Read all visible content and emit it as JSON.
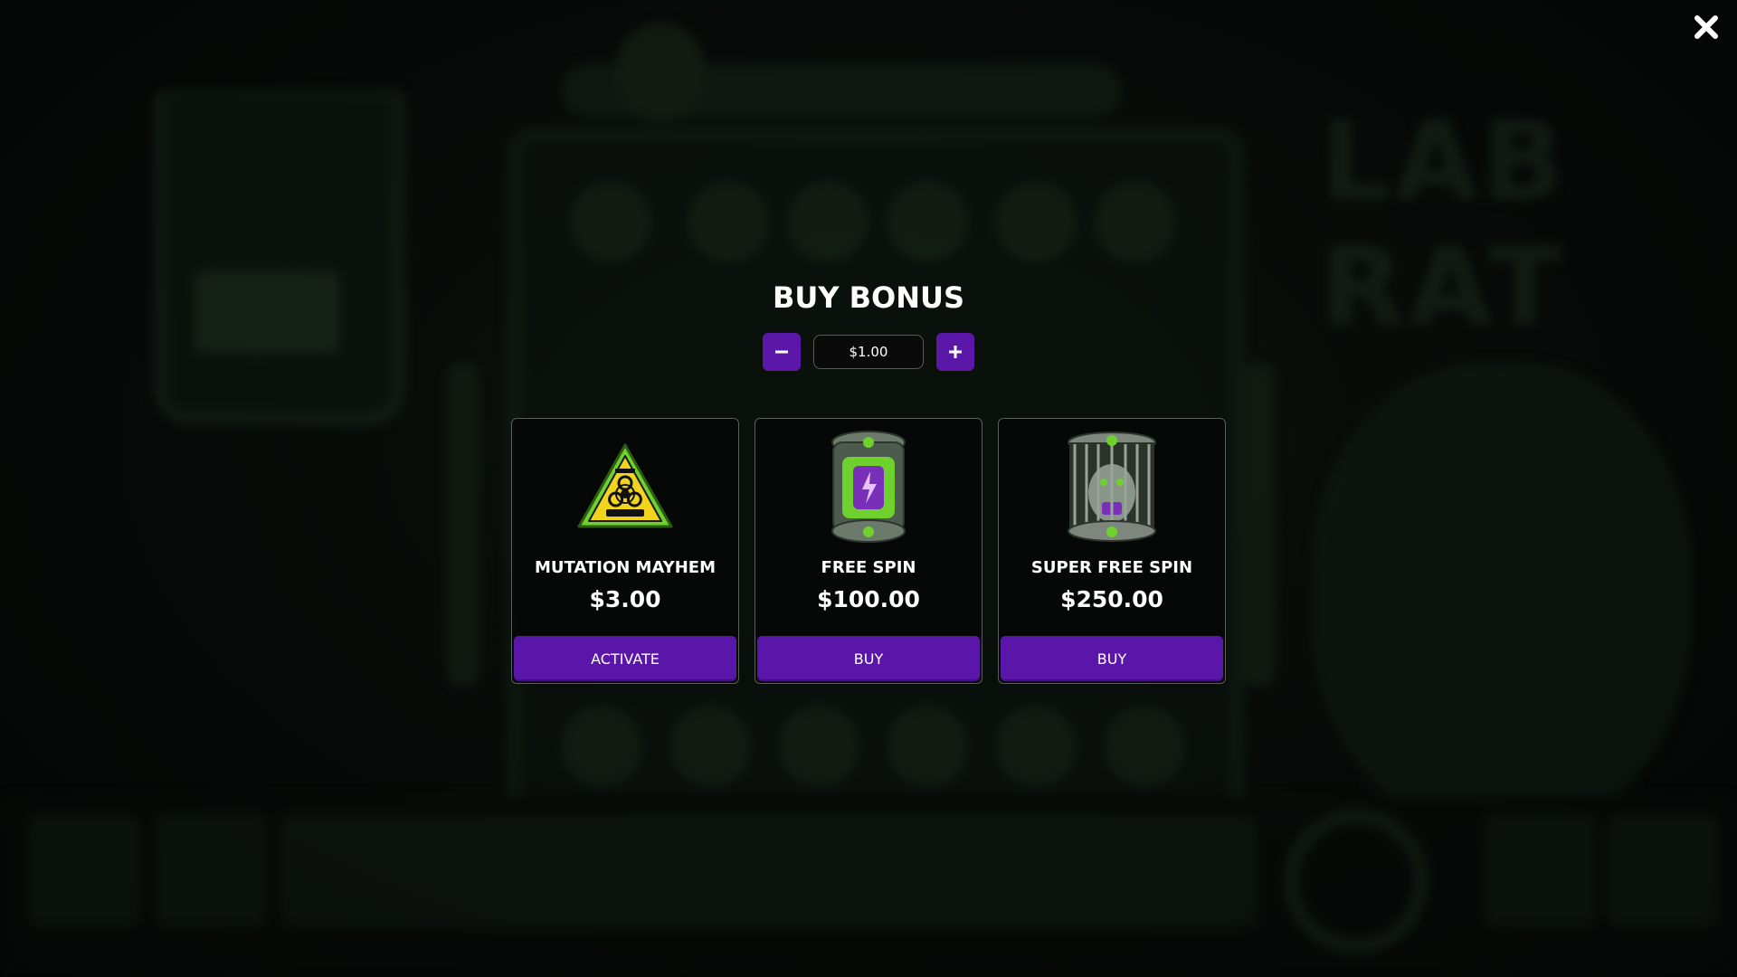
{
  "game": {
    "logo_text": "LAB RAT"
  },
  "close": {
    "icon": "close-icon"
  },
  "modal": {
    "title": "BUY BONUS",
    "stake": {
      "value": "$1.00",
      "decrease_icon": "minus-icon",
      "increase_icon": "plus-icon"
    },
    "options": [
      {
        "name": "MUTATION MAYHEM",
        "price": "$3.00",
        "action": "ACTIVATE",
        "icon": "biohazard-sign-icon"
      },
      {
        "name": "FREE SPIN",
        "price": "$100.00",
        "action": "BUY",
        "icon": "toxic-canister-icon"
      },
      {
        "name": "SUPER FREE SPIN",
        "price": "$250.00",
        "action": "BUY",
        "icon": "rat-cage-icon"
      }
    ]
  },
  "colors": {
    "accent_purple": "#5a16a8",
    "background": "#050806",
    "card_border": "#5d5d5d",
    "toxic_green": "#6fd12e"
  }
}
